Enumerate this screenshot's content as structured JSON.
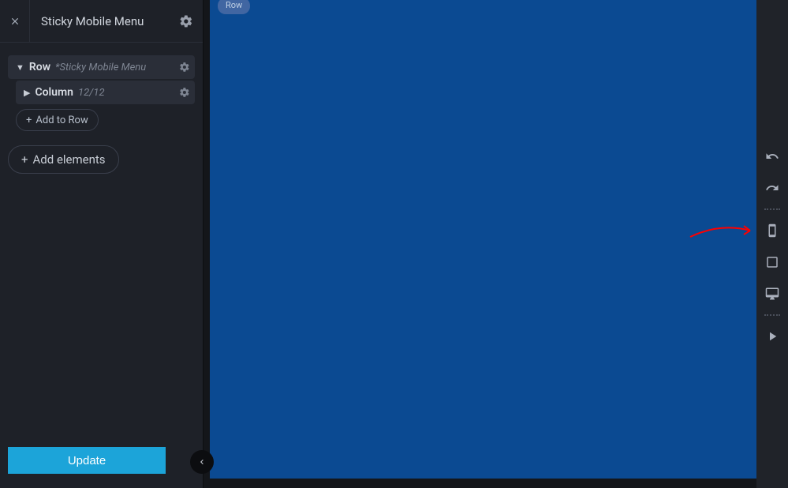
{
  "header": {
    "title": "Sticky Mobile Menu"
  },
  "tree": {
    "row": {
      "label": "Row",
      "meta": "*Sticky Mobile Menu"
    },
    "column": {
      "label": "Column",
      "meta": "12/12"
    },
    "add_to_row": "Add to Row",
    "add_elements": "Add elements"
  },
  "canvas": {
    "badge": "Row"
  },
  "footer": {
    "update": "Update"
  },
  "colors": {
    "canvas_bg": "#0b4a92",
    "update_btn": "#1ca4d9"
  }
}
